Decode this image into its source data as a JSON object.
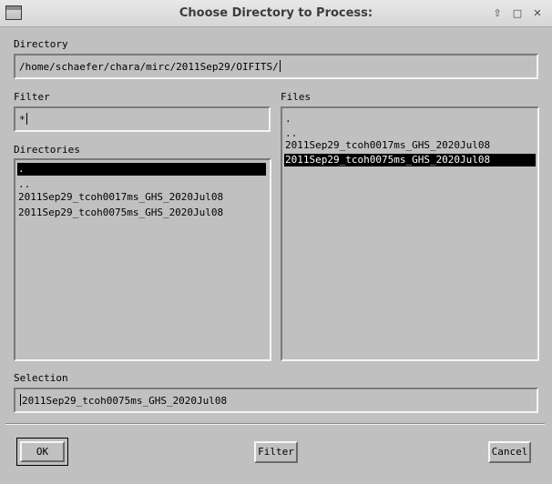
{
  "window": {
    "title": "Choose Directory to Process:",
    "controls": [
      "up-icon",
      "maximize-icon",
      "close-icon"
    ]
  },
  "directory": {
    "label": "Directory",
    "value": "/home/schaefer/chara/mirc/2011Sep29/OIFITS/"
  },
  "filter": {
    "label": "Filter",
    "value": "*"
  },
  "directories": {
    "label": "Directories",
    "items": [
      ".",
      "..",
      "2011Sep29_tcoh0017ms_GHS_2020Jul08",
      "2011Sep29_tcoh0075ms_GHS_2020Jul08"
    ],
    "selected_index": 0
  },
  "files": {
    "label": "Files",
    "items": [
      ".",
      "..",
      "2011Sep29_tcoh0017ms_GHS_2020Jul08",
      "2011Sep29_tcoh0075ms_GHS_2020Jul08"
    ],
    "selected_index": 3
  },
  "selection": {
    "label": "Selection",
    "value": "2011Sep29_tcoh0075ms_GHS_2020Jul08"
  },
  "buttons": {
    "ok": "OK",
    "filter": "Filter",
    "cancel": "Cancel"
  }
}
